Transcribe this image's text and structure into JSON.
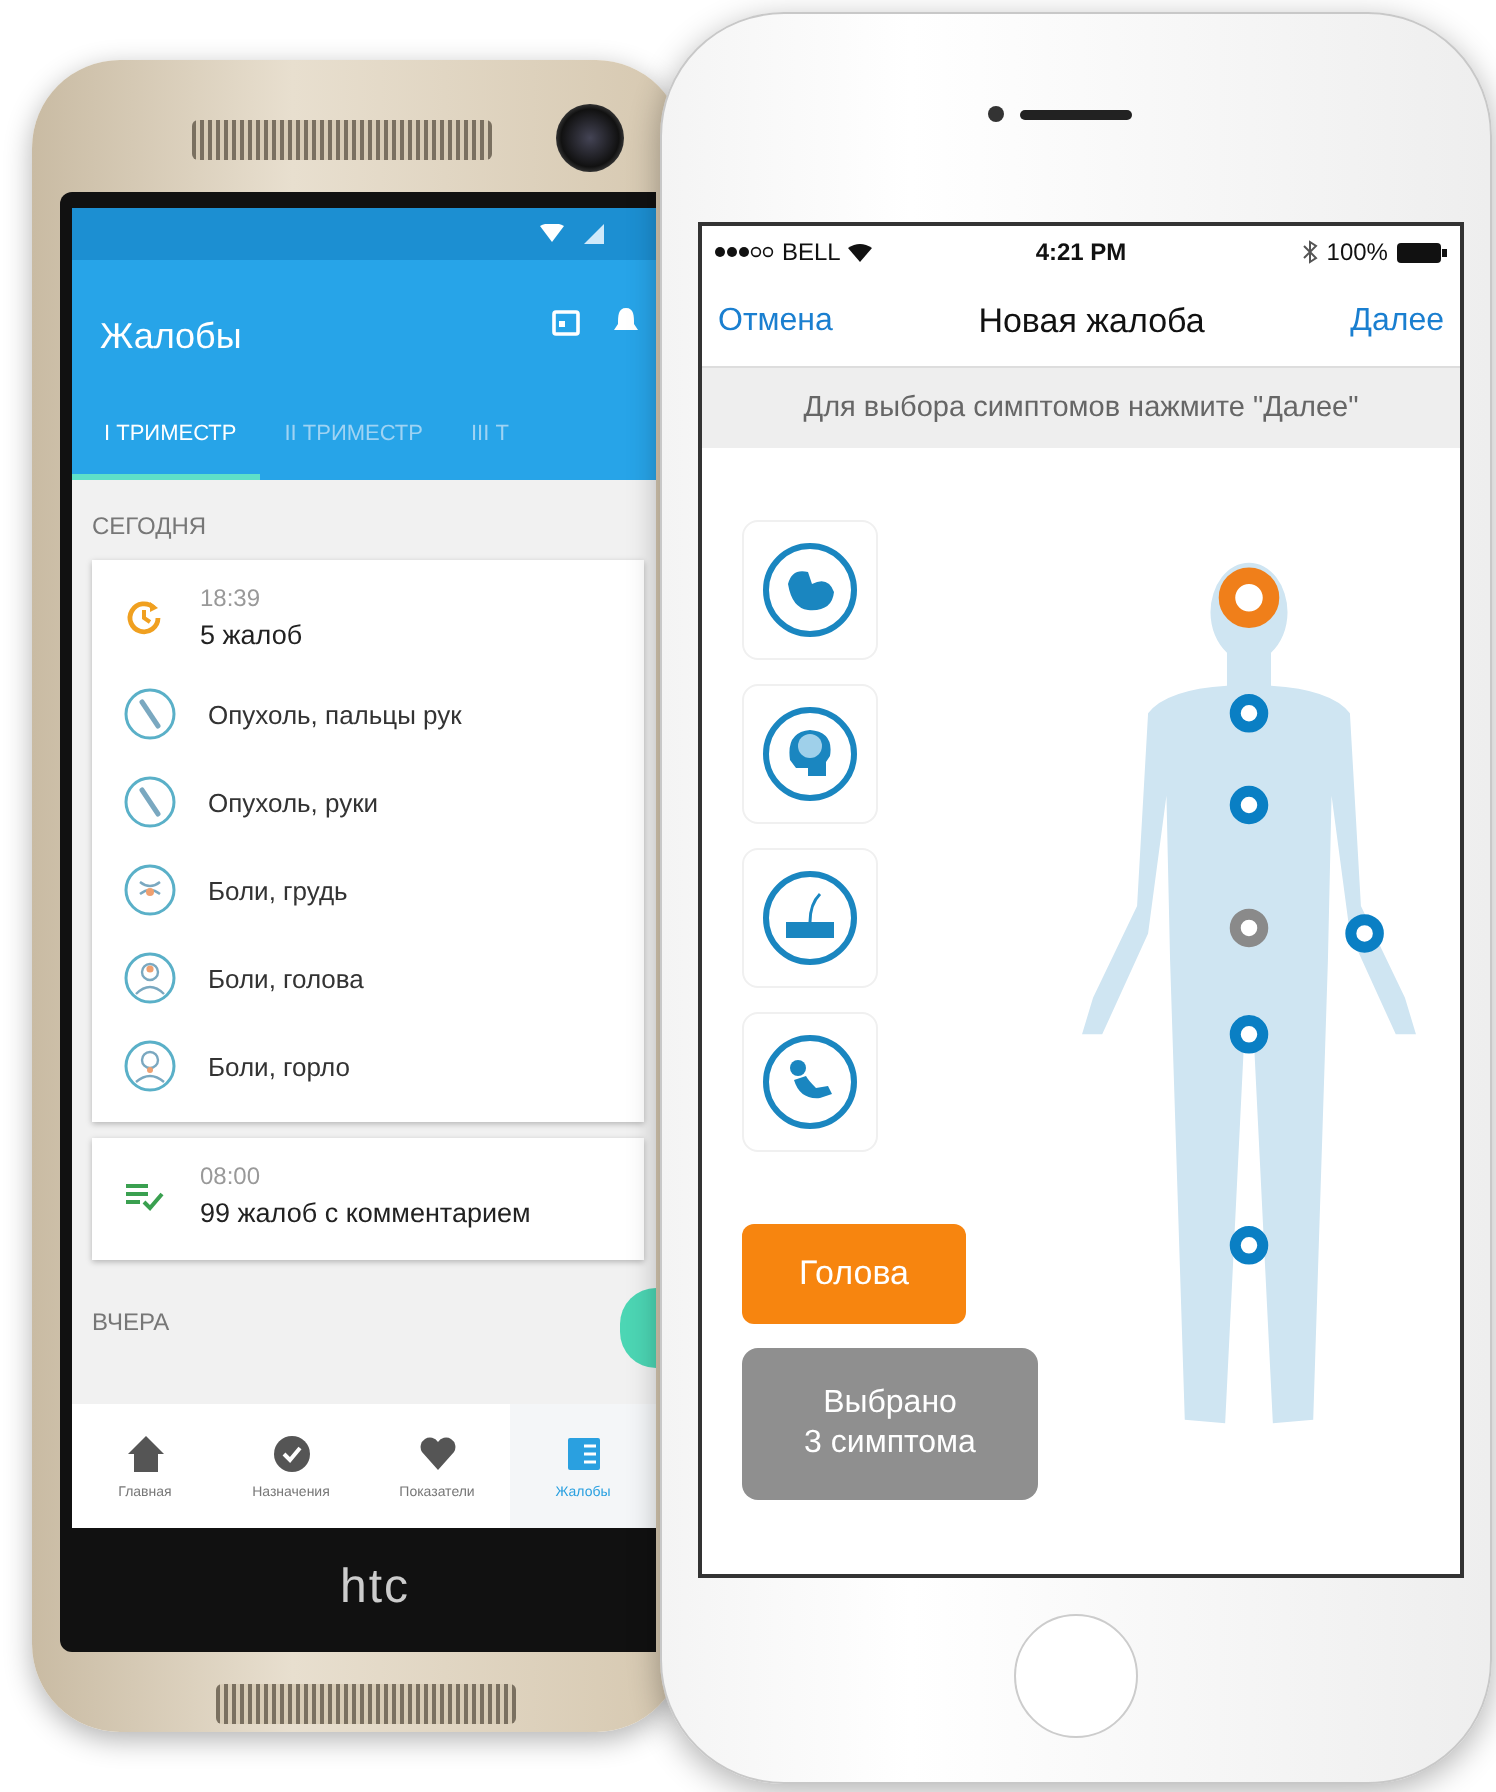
{
  "android": {
    "title": "Жалобы",
    "tabs": [
      {
        "label": "I ТРИМЕСТР",
        "selected": true
      },
      {
        "label": "II ТРИМЕСТР",
        "selected": false
      },
      {
        "label": "III Т",
        "selected": false
      }
    ],
    "sections": [
      {
        "heading": "СЕГОДНЯ",
        "entries": [
          {
            "kind": "reminder",
            "time": "18:39",
            "summary": "5 жалоб",
            "symptoms": [
              {
                "kind": "hand",
                "label": "Опухоль, пальцы рук"
              },
              {
                "kind": "hand",
                "label": "Опухоль, руки"
              },
              {
                "kind": "chest",
                "label": "Боли, грудь"
              },
              {
                "kind": "head",
                "label": "Боли, голова"
              },
              {
                "kind": "throat",
                "label": "Боли, горло"
              }
            ]
          },
          {
            "kind": "checklist",
            "time": "08:00",
            "summary": "99 жалоб с комментарием"
          }
        ]
      },
      {
        "heading": "ВЧЕРА"
      }
    ],
    "bottom_nav": [
      {
        "kind": "home",
        "label": "Главная",
        "selected": false
      },
      {
        "kind": "check",
        "label": "Назначения",
        "selected": false
      },
      {
        "kind": "heart",
        "label": "Показатели",
        "selected": false
      },
      {
        "kind": "list",
        "label": "Жалобы",
        "selected": true
      }
    ],
    "brand": "htc"
  },
  "iphone": {
    "status_bar": {
      "carrier": "BELL",
      "time": "4:21 PM",
      "battery": "100%"
    },
    "nav": {
      "cancel": "Отмена",
      "title": "Новая жалоба",
      "next": "Далее"
    },
    "hint": "Для выбора симптомов нажмите \"Далее\"",
    "categories": [
      {
        "kind": "muscle"
      },
      {
        "kind": "brain"
      },
      {
        "kind": "skin"
      },
      {
        "kind": "baby"
      }
    ],
    "markers": [
      {
        "color": "#f07f1a",
        "selected": true
      },
      {
        "color": "#0a7fc4",
        "selected": false
      },
      {
        "color": "#0a7fc4",
        "selected": false
      },
      {
        "color": "#8a8a8a",
        "selected": false
      },
      {
        "color": "#0a7fc4",
        "selected": false
      },
      {
        "color": "#0a7fc4",
        "selected": false
      },
      {
        "color": "#0a7fc4",
        "selected": false
      }
    ],
    "area_button": "Голова",
    "summary_button": [
      "Выбрано",
      "3 симптома"
    ]
  }
}
